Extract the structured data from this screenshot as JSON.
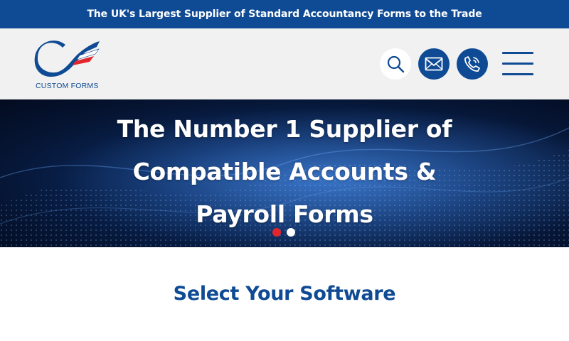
{
  "announcement": {
    "text": "The UK's Largest Supplier of Standard Accountancy Forms to the Trade"
  },
  "header": {
    "logo_text": "CUSTOM FORMS",
    "actions": [
      {
        "name": "search",
        "icon": "search-icon"
      },
      {
        "name": "email",
        "icon": "mail-icon"
      },
      {
        "name": "phone",
        "icon": "phone-icon"
      },
      {
        "name": "menu",
        "icon": "hamburger-menu-icon"
      }
    ]
  },
  "hero": {
    "title_lines": [
      "The Number 1 Supplier of",
      "Compatible Accounts &",
      "Payroll Forms"
    ],
    "slides_total": 2,
    "active_slide": 1
  },
  "software_section": {
    "title": "Select Your Software"
  },
  "colors": {
    "brand_blue": "#0f4a94",
    "accent_red": "#e3262b",
    "header_bg": "#f1f1f1",
    "hero_dark": "#061636"
  }
}
